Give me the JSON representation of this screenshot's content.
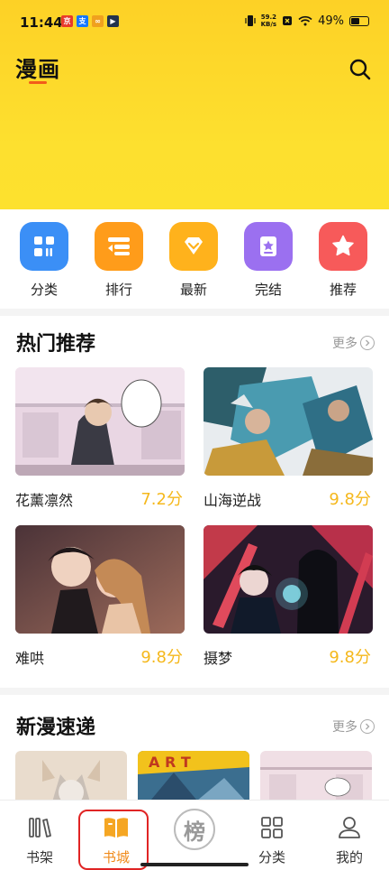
{
  "status_bar": {
    "time": "11:44",
    "net_speed_value": "59.2",
    "net_speed_unit": "KB/s",
    "battery": "49%"
  },
  "header": {
    "title": "漫画"
  },
  "categories": [
    {
      "label": "分类",
      "icon": "grid-icon",
      "color": "#3b8ff6"
    },
    {
      "label": "排行",
      "icon": "rank-list-icon",
      "color": "#ff9c1a"
    },
    {
      "label": "最新",
      "icon": "diamond-icon",
      "color": "#ffb21c"
    },
    {
      "label": "完结",
      "icon": "star-book-icon",
      "color": "#9b70f0"
    },
    {
      "label": "推荐",
      "icon": "star-icon",
      "color": "#f75a5a"
    }
  ],
  "hot": {
    "title": "热门推荐",
    "more": "更多",
    "items": [
      {
        "title": "花薰凛然",
        "score": "7.2分"
      },
      {
        "title": "山海逆战",
        "score": "9.8分"
      },
      {
        "title": "难哄",
        "score": "9.8分"
      },
      {
        "title": "摄梦",
        "score": "9.8分"
      }
    ]
  },
  "new_section": {
    "title": "新漫速递",
    "more": "更多"
  },
  "bottom_nav": [
    {
      "label": "书架",
      "icon": "bookshelf-icon"
    },
    {
      "label": "书城",
      "icon": "book-open-icon",
      "active": true
    },
    {
      "label": "榜",
      "icon": "ranking-badge-icon"
    },
    {
      "label": "分类",
      "icon": "grid-icon"
    },
    {
      "label": "我的",
      "icon": "user-icon"
    }
  ],
  "colors": {
    "header_yellow": "#fdd126",
    "score": "#f5b81c",
    "accent_orange": "#f08a1a",
    "highlight_red": "#e02424"
  }
}
